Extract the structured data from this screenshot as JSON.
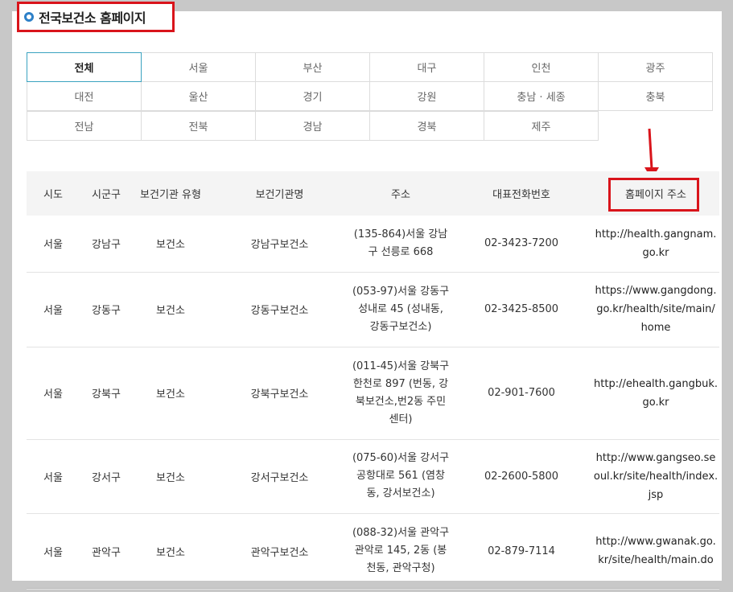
{
  "title": "전국보건소 홈페이지",
  "regions": [
    [
      "전체",
      "서울",
      "부산",
      "대구",
      "인천",
      "광주"
    ],
    [
      "대전",
      "울산",
      "경기",
      "강원",
      "충남 · 세종",
      "충북"
    ],
    [
      "전남",
      "전북",
      "경남",
      "경북",
      "제주"
    ]
  ],
  "active_region": "전체",
  "table": {
    "headers": [
      "시도",
      "시군구",
      "보건기관 유형",
      "보건기관명",
      "주소",
      "대표전화번호",
      "홈페이지 주소"
    ],
    "rows": [
      {
        "sido": "서울",
        "sigungu": "강남구",
        "type": "보건소",
        "name": "강남구보건소",
        "addr": [
          "(135-864)서울  강남",
          "구 선릉로 668"
        ],
        "phone": "02-3423-7200",
        "url": [
          "http://health.gangnam.",
          "go.kr"
        ]
      },
      {
        "sido": "서울",
        "sigungu": "강동구",
        "type": "보건소",
        "name": "강동구보건소",
        "addr": [
          "(053-97)서울 강동구",
          "성내로 45 (성내동,",
          "강동구보건소)"
        ],
        "phone": "02-3425-8500",
        "url": [
          "https://www.gangdong.",
          "go.kr/health/site/main/",
          "home"
        ]
      },
      {
        "sido": "서울",
        "sigungu": "강북구",
        "type": "보건소",
        "name": "강북구보건소",
        "addr": [
          "(011-45)서울 강북구",
          "한천로 897 (번동, 강",
          "북보건소,번2동 주민",
          "센터)"
        ],
        "phone": "02-901-7600",
        "url": [
          "http://ehealth.gangbuk.",
          "go.kr"
        ]
      },
      {
        "sido": "서울",
        "sigungu": "강서구",
        "type": "보건소",
        "name": "강서구보건소",
        "addr": [
          "(075-60)서울 강서구",
          "공항대로 561 (염창",
          "동, 강서보건소)"
        ],
        "phone": "02-2600-5800",
        "url": [
          "http://www.gangseo.se",
          "oul.kr/site/health/index.",
          "jsp"
        ]
      },
      {
        "sido": "서울",
        "sigungu": "관악구",
        "type": "보건소",
        "name": "관악구보건소",
        "addr": [
          "(088-32)서울 관악구",
          "관악로 145, 2동 (봉",
          "천동, 관악구청)"
        ],
        "phone": "02-879-7114",
        "url": [
          "http://www.gwanak.go.",
          "kr/site/health/main.do"
        ]
      }
    ]
  },
  "colors": {
    "highlight": "#d9141b",
    "accent": "#2d80c8",
    "active_border": "#3aa3c0"
  }
}
